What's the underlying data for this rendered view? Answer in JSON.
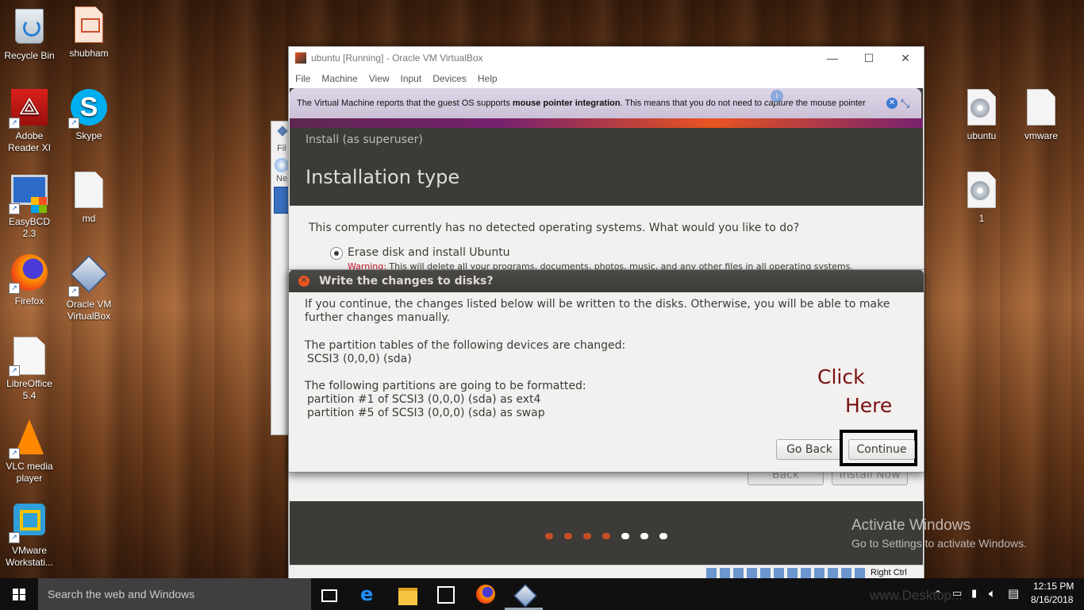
{
  "desktop": {
    "icons_left": [
      {
        "label": "Recycle Bin",
        "icon": "recycle-bin-icon"
      },
      {
        "label": "shubham",
        "icon": "presentation-file-icon"
      },
      {
        "label": "Adobe Reader XI",
        "icon": "adobe-reader-icon"
      },
      {
        "label": "Skype",
        "icon": "skype-icon"
      },
      {
        "label": "EasyBCD 2.3",
        "icon": "easybcd-icon"
      },
      {
        "label": "md",
        "icon": "text-file-icon"
      },
      {
        "label": "Firefox",
        "icon": "firefox-icon"
      },
      {
        "label": "Oracle VM VirtualBox",
        "icon": "virtualbox-icon"
      },
      {
        "label": "LibreOffice 5.4",
        "icon": "libreoffice-icon"
      },
      {
        "label": "VLC media player",
        "icon": "vlc-icon"
      },
      {
        "label": "VMware Workstati...",
        "icon": "vmware-icon"
      }
    ],
    "icons_right": [
      {
        "label": "ubuntu",
        "icon": "disc-image-icon"
      },
      {
        "label": "vmware",
        "icon": "text-file-icon"
      },
      {
        "label": "1",
        "icon": "disc-image-icon"
      }
    ],
    "watermark": {
      "title": "Activate Windows",
      "subtitle": "Go to Settings to activate Windows."
    },
    "annotation": {
      "line1": "Click",
      "line2": "Here"
    }
  },
  "vbox": {
    "title": "ubuntu [Running] - Oracle VM VirtualBox",
    "menu": [
      "File",
      "Machine",
      "View",
      "Input",
      "Devices",
      "Help"
    ],
    "notify_pre": "The Virtual Machine reports that the guest OS supports ",
    "notify_bold": "mouse pointer integration",
    "notify_mid": ". This means that you do not need to ",
    "notify_italic": "capture",
    "notify_post": " the mouse pointer",
    "status_host_key": "Right Ctrl",
    "bg_window": {
      "file": "Fil",
      "new": "Ne"
    }
  },
  "installer": {
    "bar_title": "Install (as superuser)",
    "heading": "Installation type",
    "question": "This computer currently has no detected operating systems. What would you like to do?",
    "option1": "Erase disk and install Ubuntu",
    "warning_label": "Warning:",
    "warning_text": " This will delete all your programs, documents, photos, music, and any other files in all operating systems.",
    "back_label": "Back",
    "install_now_label": "Install Now",
    "progress_dots": {
      "total": 7,
      "completed": 4
    }
  },
  "dialog": {
    "title": "Write the changes to disks?",
    "intro": "If you continue, the changes listed below will be written to the disks. Otherwise, you will be able to make further changes manually.",
    "tables_heading": "The partition tables of the following devices are changed:",
    "tables_device": "SCSI3 (0,0,0) (sda)",
    "format_heading": "The following partitions are going to be formatted:",
    "partitions": [
      "partition #1 of SCSI3 (0,0,0) (sda) as ext4",
      "partition #5 of SCSI3 (0,0,0) (sda) as swap"
    ],
    "go_back_label": "Go Back",
    "continue_label": "Continue"
  },
  "taskbar": {
    "search_placeholder": "Search the web and Windows",
    "time": "12:15 PM",
    "date": "8/16/2018",
    "site_watermark": "www.Desktop..."
  },
  "colors": {
    "ubuntu_orange": "#e95420",
    "ubuntu_dark": "#3c3b37",
    "annotation": "#7a0f0f"
  }
}
